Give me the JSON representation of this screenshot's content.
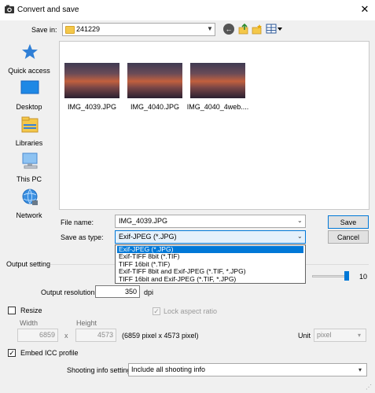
{
  "window": {
    "title": "Convert and save",
    "close_glyph": "✕"
  },
  "toolbar": {
    "save_in_label": "Save in:",
    "save_in_value": "241229",
    "back_glyph": "←",
    "icons": [
      "folder-icon",
      "back-icon",
      "up-folder-icon",
      "new-folder-icon",
      "view-menu-icon"
    ]
  },
  "places": [
    {
      "label": "Quick access",
      "icon": "star-icon"
    },
    {
      "label": "Desktop",
      "icon": "desktop-icon"
    },
    {
      "label": "Libraries",
      "icon": "libraries-icon"
    },
    {
      "label": "This PC",
      "icon": "computer-icon"
    },
    {
      "label": "Network",
      "icon": "network-icon"
    }
  ],
  "files": [
    {
      "name": "IMG_4039.JPG"
    },
    {
      "name": "IMG_4040.JPG"
    },
    {
      "name": "IMG_4040_4web...."
    }
  ],
  "form": {
    "file_name_label": "File name:",
    "file_name_value": "IMG_4039.JPG",
    "save_as_label": "Save as type:",
    "save_as_value": "Exif-JPEG (*.JPG)",
    "save_button": "Save",
    "cancel_button": "Cancel"
  },
  "type_options": [
    "Exif-JPEG (*.JPG)",
    "Exif-TIFF 8bit (*.TIF)",
    "TIFF 16bit (*.TIF)",
    "Exif-TIFF 8bit and Exif-JPEG (*.TIF, *.JPG)",
    "TIFF 16bit and Exif-JPEG (*.TIF, *.JPG)"
  ],
  "output": {
    "section_label": "Output setting",
    "quality_value": "10",
    "quality_level": 1.0,
    "resolution_label": "Output resolution",
    "resolution_value": "350",
    "resolution_unit": "dpi",
    "resize_label": "Resize",
    "lock_aspect_label": "Lock aspect ratio",
    "width_label": "Width",
    "height_label": "Height",
    "width_value": "6859",
    "height_value": "4573",
    "x_sign": "x",
    "pixel_info": "(6859 pixel x 4573 pixel)",
    "unit_label": "Unit",
    "unit_value": "pixel",
    "embed_icc_label": "Embed ICC profile",
    "shooting_info_label": "Shooting info setting",
    "shooting_info_value": "Include all shooting info",
    "checked_glyph": "✓"
  },
  "colors": {
    "accent": "#0078d7",
    "panel": "#f0f0f0"
  }
}
